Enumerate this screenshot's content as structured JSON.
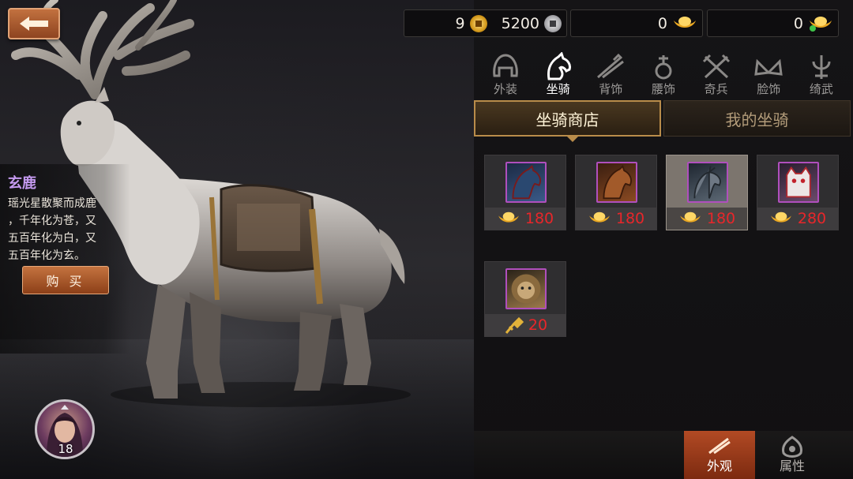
{
  "currency": {
    "gold_coin": "9",
    "silver_coin": "5200",
    "ingot_a": "0",
    "ingot_b": "0"
  },
  "category_tabs": [
    {
      "label": "外装",
      "icon": "helmet-icon"
    },
    {
      "label": "坐骑",
      "icon": "horse-icon"
    },
    {
      "label": "背饰",
      "icon": "back-ornament-icon"
    },
    {
      "label": "腰饰",
      "icon": "waist-ornament-icon"
    },
    {
      "label": "奇兵",
      "icon": "crossed-blades-icon"
    },
    {
      "label": "脸饰",
      "icon": "face-wings-icon"
    },
    {
      "label": "绮武",
      "icon": "ornate-weapon-icon"
    }
  ],
  "sub_tabs": {
    "shop": "坐骑商店",
    "mine": "我的坐骑"
  },
  "mount": {
    "name": "玄鹿",
    "description": "瑶光星散聚而成鹿\n，千年化为苍，又\n五百年化为白，又\n五百年化为玄。",
    "buy_label": "购 买"
  },
  "shop_items": [
    {
      "name": "dark-blue-warhorse",
      "price": "180",
      "currency": "gold-ingot-icon",
      "selected": false,
      "color": "#3a5a88"
    },
    {
      "name": "chestnut-horse",
      "price": "180",
      "currency": "gold-ingot-icon",
      "selected": false,
      "color": "#8a4a22"
    },
    {
      "name": "gray-deer",
      "price": "180",
      "currency": "gold-ingot-icon",
      "selected": true,
      "color": "#5c6874"
    },
    {
      "name": "lucky-cat",
      "price": "280",
      "currency": "gold-ingot-icon",
      "selected": false,
      "color": "#e8e0e0"
    },
    {
      "name": "lion-beast",
      "price": "20",
      "currency": "key-token-icon",
      "selected": false,
      "color": "#9c7a4a"
    }
  ],
  "bottom_tabs": {
    "appearance": "外观",
    "attributes": "属性"
  },
  "player": {
    "level": "18"
  }
}
